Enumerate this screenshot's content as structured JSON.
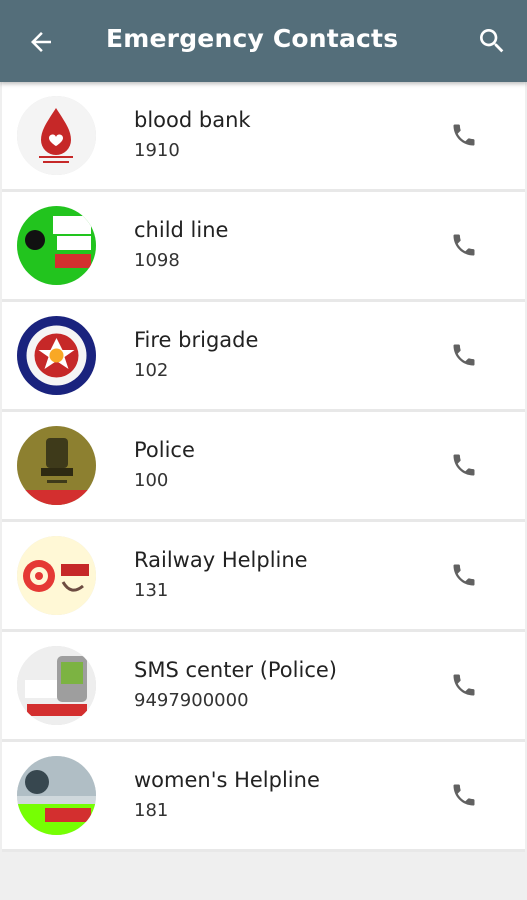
{
  "appbar": {
    "title": "Emergency Contacts",
    "back_icon": "arrow-back-icon",
    "search_icon": "search-icon",
    "color": "#546e7a"
  },
  "contacts": [
    {
      "name": "blood bank",
      "number": "1910"
    },
    {
      "name": "child line",
      "number": "1098"
    },
    {
      "name": "Fire brigade",
      "number": "102"
    },
    {
      "name": "Police",
      "number": "100"
    },
    {
      "name": "Railway Helpline",
      "number": "131"
    },
    {
      "name": "SMS center (Police)",
      "number": "9497900000"
    },
    {
      "name": "women's Helpline",
      "number": "181"
    }
  ],
  "call_icon": "phone-icon"
}
